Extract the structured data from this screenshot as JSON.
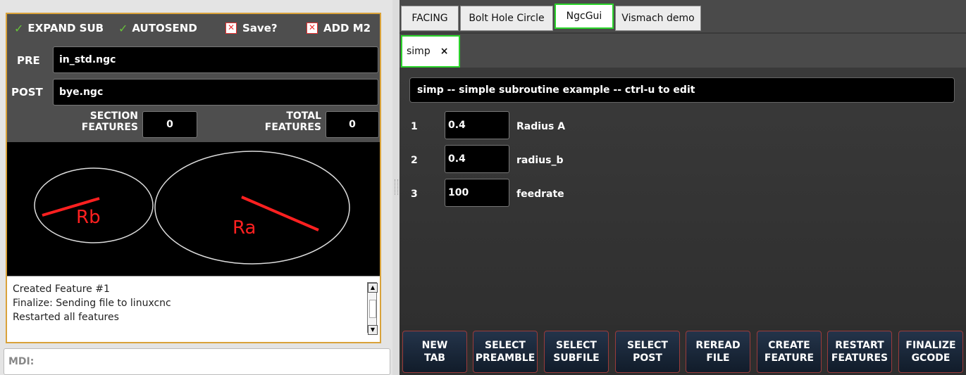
{
  "left": {
    "checkboxes": [
      {
        "label": "EXPAND SUB",
        "state": "checked"
      },
      {
        "label": "AUTOSEND",
        "state": "checked"
      },
      {
        "label": "Save?",
        "state": "crossed"
      },
      {
        "label": "ADD M2",
        "state": "crossed"
      }
    ],
    "pre": {
      "label": "PRE",
      "value": "in_std.ngc"
    },
    "post": {
      "label": "POST",
      "value": "bye.ngc"
    },
    "section_features": {
      "label_line1": "SECTION",
      "label_line2": "FEATURES",
      "value": "0"
    },
    "total_features": {
      "label_line1": "TOTAL",
      "label_line2": "FEATURES",
      "value": "0"
    },
    "preview": {
      "label_rb": "Rb",
      "label_ra": "Ra"
    },
    "log": [
      "Created Feature #1",
      "Finalize: Sending file to linuxcnc",
      "Restarted all features"
    ]
  },
  "mdi": {
    "label": "MDI:"
  },
  "right": {
    "tabs": [
      "FACING",
      "Bolt Hole Circle",
      "NgcGui",
      "Vismach demo"
    ],
    "active_tab": "NgcGui",
    "subtab": {
      "label": "simp",
      "close": "×"
    },
    "description": "simp -- simple subroutine example -- ctrl-u to edit",
    "params": [
      {
        "num": "1",
        "value": "0.4",
        "name": "Radius A"
      },
      {
        "num": "2",
        "value": "0.4",
        "name": "radius_b"
      },
      {
        "num": "3",
        "value": "100",
        "name": "feedrate"
      }
    ],
    "buttons": [
      "NEW\nTAB",
      "SELECT\nPREAMBLE",
      "SELECT\nSUBFILE",
      "SELECT\nPOST",
      "REREAD\nFILE",
      "CREATE\nFEATURE",
      "RESTART\nFEATURES",
      "FINALIZE\nGCODE"
    ]
  },
  "colors": {
    "accent_green": "#2bd42b",
    "panel_border": "#d9a23a",
    "check_green": "#67c23a",
    "ray_red": "#ff2020"
  }
}
